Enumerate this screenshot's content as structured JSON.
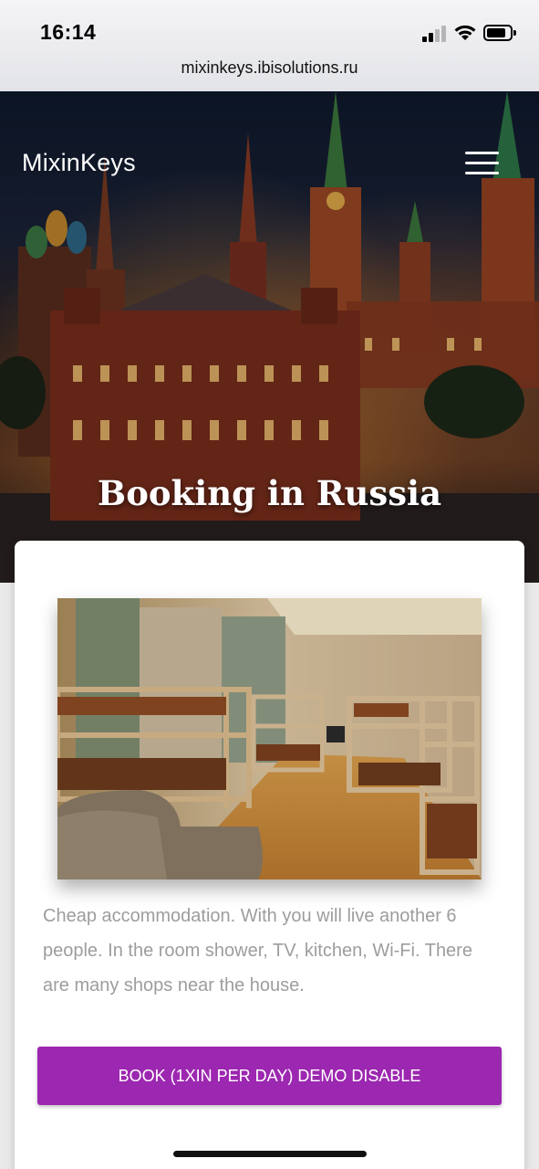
{
  "status_bar": {
    "time": "16:14",
    "url": "mixinkeys.ibisolutions.ru"
  },
  "header": {
    "brand": "MixinKeys",
    "menu_icon": "hamburger-menu-icon"
  },
  "hero": {
    "title": "Booking in Russia"
  },
  "card": {
    "description": "Cheap accommodation. With you will live another 6 people. In the room shower, TV, kitchen, Wi-Fi. There are many shops near the house.",
    "book_label": "BOOK (1XIN PER DAY) DEMO DISABLE"
  },
  "colors": {
    "accent": "#9c27b0",
    "description_text": "#9d9d9d"
  }
}
